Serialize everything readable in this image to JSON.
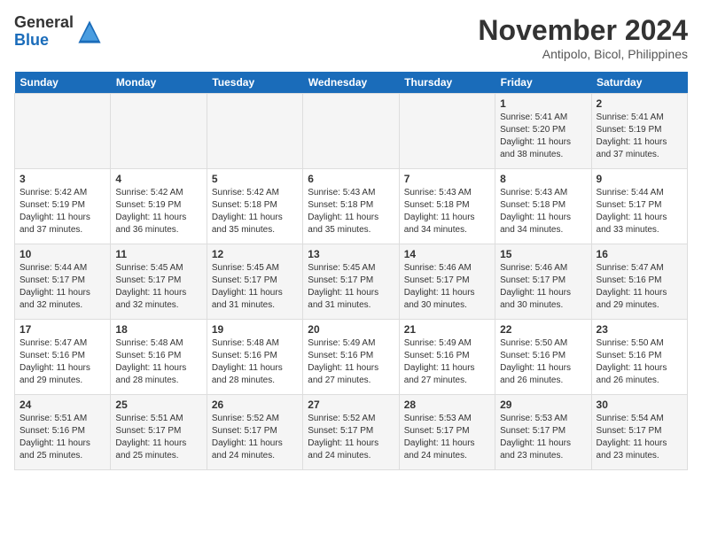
{
  "logo": {
    "general": "General",
    "blue": "Blue"
  },
  "header": {
    "month": "November 2024",
    "location": "Antipolo, Bicol, Philippines"
  },
  "weekdays": [
    "Sunday",
    "Monday",
    "Tuesday",
    "Wednesday",
    "Thursday",
    "Friday",
    "Saturday"
  ],
  "weeks": [
    [
      {
        "day": "",
        "info": ""
      },
      {
        "day": "",
        "info": ""
      },
      {
        "day": "",
        "info": ""
      },
      {
        "day": "",
        "info": ""
      },
      {
        "day": "",
        "info": ""
      },
      {
        "day": "1",
        "info": "Sunrise: 5:41 AM\nSunset: 5:20 PM\nDaylight: 11 hours and 38 minutes."
      },
      {
        "day": "2",
        "info": "Sunrise: 5:41 AM\nSunset: 5:19 PM\nDaylight: 11 hours and 37 minutes."
      }
    ],
    [
      {
        "day": "3",
        "info": "Sunrise: 5:42 AM\nSunset: 5:19 PM\nDaylight: 11 hours and 37 minutes."
      },
      {
        "day": "4",
        "info": "Sunrise: 5:42 AM\nSunset: 5:19 PM\nDaylight: 11 hours and 36 minutes."
      },
      {
        "day": "5",
        "info": "Sunrise: 5:42 AM\nSunset: 5:18 PM\nDaylight: 11 hours and 35 minutes."
      },
      {
        "day": "6",
        "info": "Sunrise: 5:43 AM\nSunset: 5:18 PM\nDaylight: 11 hours and 35 minutes."
      },
      {
        "day": "7",
        "info": "Sunrise: 5:43 AM\nSunset: 5:18 PM\nDaylight: 11 hours and 34 minutes."
      },
      {
        "day": "8",
        "info": "Sunrise: 5:43 AM\nSunset: 5:18 PM\nDaylight: 11 hours and 34 minutes."
      },
      {
        "day": "9",
        "info": "Sunrise: 5:44 AM\nSunset: 5:17 PM\nDaylight: 11 hours and 33 minutes."
      }
    ],
    [
      {
        "day": "10",
        "info": "Sunrise: 5:44 AM\nSunset: 5:17 PM\nDaylight: 11 hours and 32 minutes."
      },
      {
        "day": "11",
        "info": "Sunrise: 5:45 AM\nSunset: 5:17 PM\nDaylight: 11 hours and 32 minutes."
      },
      {
        "day": "12",
        "info": "Sunrise: 5:45 AM\nSunset: 5:17 PM\nDaylight: 11 hours and 31 minutes."
      },
      {
        "day": "13",
        "info": "Sunrise: 5:45 AM\nSunset: 5:17 PM\nDaylight: 11 hours and 31 minutes."
      },
      {
        "day": "14",
        "info": "Sunrise: 5:46 AM\nSunset: 5:17 PM\nDaylight: 11 hours and 30 minutes."
      },
      {
        "day": "15",
        "info": "Sunrise: 5:46 AM\nSunset: 5:17 PM\nDaylight: 11 hours and 30 minutes."
      },
      {
        "day": "16",
        "info": "Sunrise: 5:47 AM\nSunset: 5:16 PM\nDaylight: 11 hours and 29 minutes."
      }
    ],
    [
      {
        "day": "17",
        "info": "Sunrise: 5:47 AM\nSunset: 5:16 PM\nDaylight: 11 hours and 29 minutes."
      },
      {
        "day": "18",
        "info": "Sunrise: 5:48 AM\nSunset: 5:16 PM\nDaylight: 11 hours and 28 minutes."
      },
      {
        "day": "19",
        "info": "Sunrise: 5:48 AM\nSunset: 5:16 PM\nDaylight: 11 hours and 28 minutes."
      },
      {
        "day": "20",
        "info": "Sunrise: 5:49 AM\nSunset: 5:16 PM\nDaylight: 11 hours and 27 minutes."
      },
      {
        "day": "21",
        "info": "Sunrise: 5:49 AM\nSunset: 5:16 PM\nDaylight: 11 hours and 27 minutes."
      },
      {
        "day": "22",
        "info": "Sunrise: 5:50 AM\nSunset: 5:16 PM\nDaylight: 11 hours and 26 minutes."
      },
      {
        "day": "23",
        "info": "Sunrise: 5:50 AM\nSunset: 5:16 PM\nDaylight: 11 hours and 26 minutes."
      }
    ],
    [
      {
        "day": "24",
        "info": "Sunrise: 5:51 AM\nSunset: 5:16 PM\nDaylight: 11 hours and 25 minutes."
      },
      {
        "day": "25",
        "info": "Sunrise: 5:51 AM\nSunset: 5:17 PM\nDaylight: 11 hours and 25 minutes."
      },
      {
        "day": "26",
        "info": "Sunrise: 5:52 AM\nSunset: 5:17 PM\nDaylight: 11 hours and 24 minutes."
      },
      {
        "day": "27",
        "info": "Sunrise: 5:52 AM\nSunset: 5:17 PM\nDaylight: 11 hours and 24 minutes."
      },
      {
        "day": "28",
        "info": "Sunrise: 5:53 AM\nSunset: 5:17 PM\nDaylight: 11 hours and 24 minutes."
      },
      {
        "day": "29",
        "info": "Sunrise: 5:53 AM\nSunset: 5:17 PM\nDaylight: 11 hours and 23 minutes."
      },
      {
        "day": "30",
        "info": "Sunrise: 5:54 AM\nSunset: 5:17 PM\nDaylight: 11 hours and 23 minutes."
      }
    ]
  ]
}
